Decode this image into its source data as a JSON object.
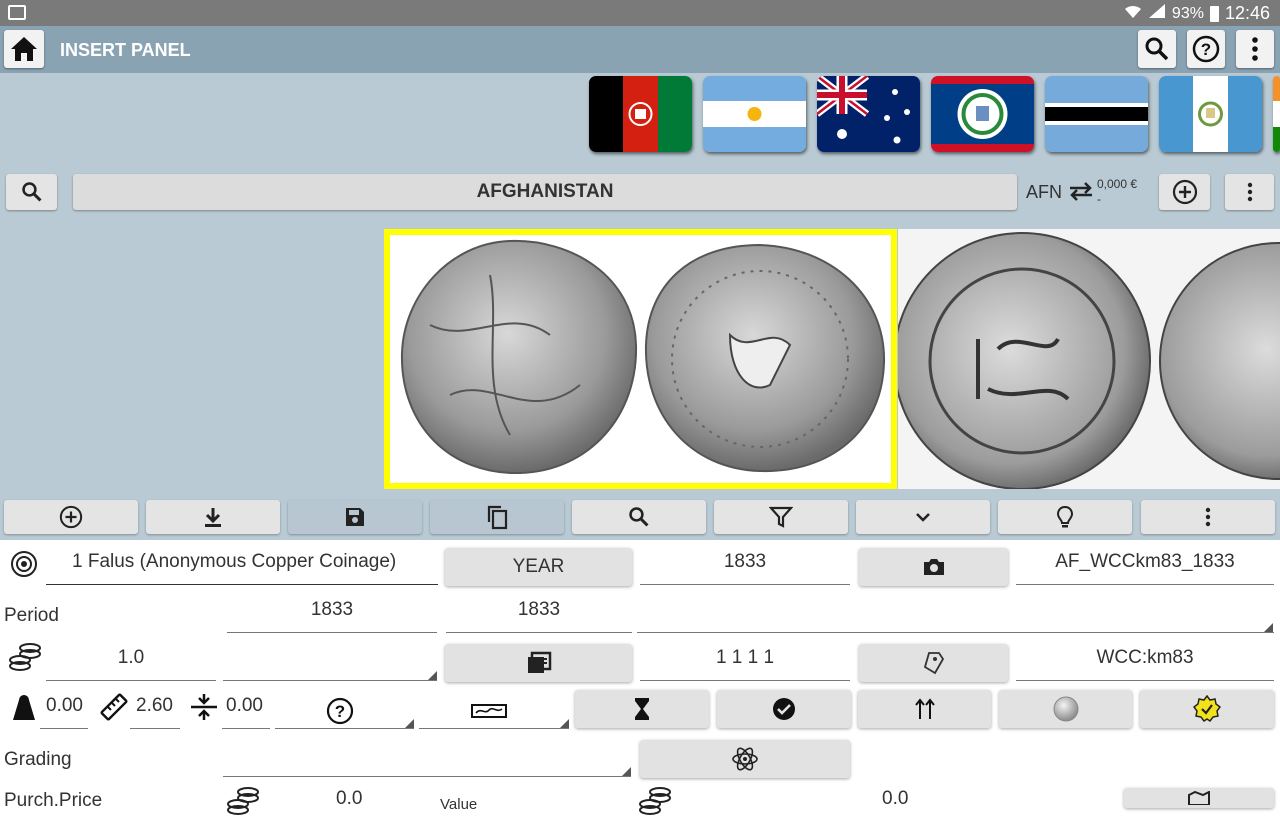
{
  "status": {
    "battery": "93%",
    "time": "12:46"
  },
  "appbar": {
    "title": "INSERT PANEL"
  },
  "flags": [
    {
      "name": "Afghanistan"
    },
    {
      "name": "Argentina"
    },
    {
      "name": "Australia"
    },
    {
      "name": "Belize"
    },
    {
      "name": "Botswana"
    },
    {
      "name": "Guatemala"
    },
    {
      "name": "India"
    }
  ],
  "country": {
    "name": "AFGHANISTAN",
    "currency_code": "AFN",
    "currency_value": "0,000 €",
    "currency_sub": "-"
  },
  "form": {
    "coin_name": "1 Falus (Anonymous Copper Coinage)",
    "year_button": "YEAR",
    "year_value": "1833",
    "image_code": "AF_WCCkm83_1833",
    "period_label": "Period",
    "period_from": "1833",
    "period_to": "1833",
    "quantity": "1.0",
    "catalog_number": "1 1 1 1",
    "catalog_ref": "WCC:km83",
    "weight": "0.00",
    "size": "2.60",
    "thickness": "0.00",
    "grading_label": "Grading",
    "purch_label": "Purch.Price",
    "purch_value": "0.0",
    "value_label": "Value",
    "value_value": "0.0"
  }
}
